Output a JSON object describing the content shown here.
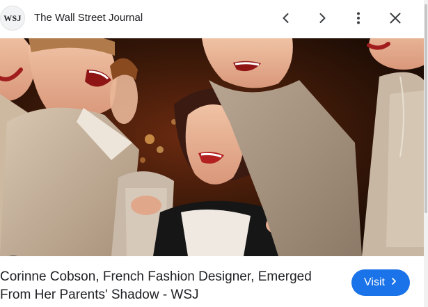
{
  "source": {
    "logo_text": "WSJ",
    "name": "The Wall Street Journal"
  },
  "header_controls": {
    "prev_icon": "chevron-left-icon",
    "next_icon": "chevron-right-icon",
    "more_icon": "more-vert-icon",
    "close_icon": "close-icon"
  },
  "image": {
    "lens_icon": "google-lens-icon"
  },
  "caption": {
    "title": "Corinne Cobson, French Fashion Designer, Emerged From Her Parents' Shadow - WSJ"
  },
  "visit_button": {
    "label": "Visit",
    "color": "#1a73e8"
  }
}
